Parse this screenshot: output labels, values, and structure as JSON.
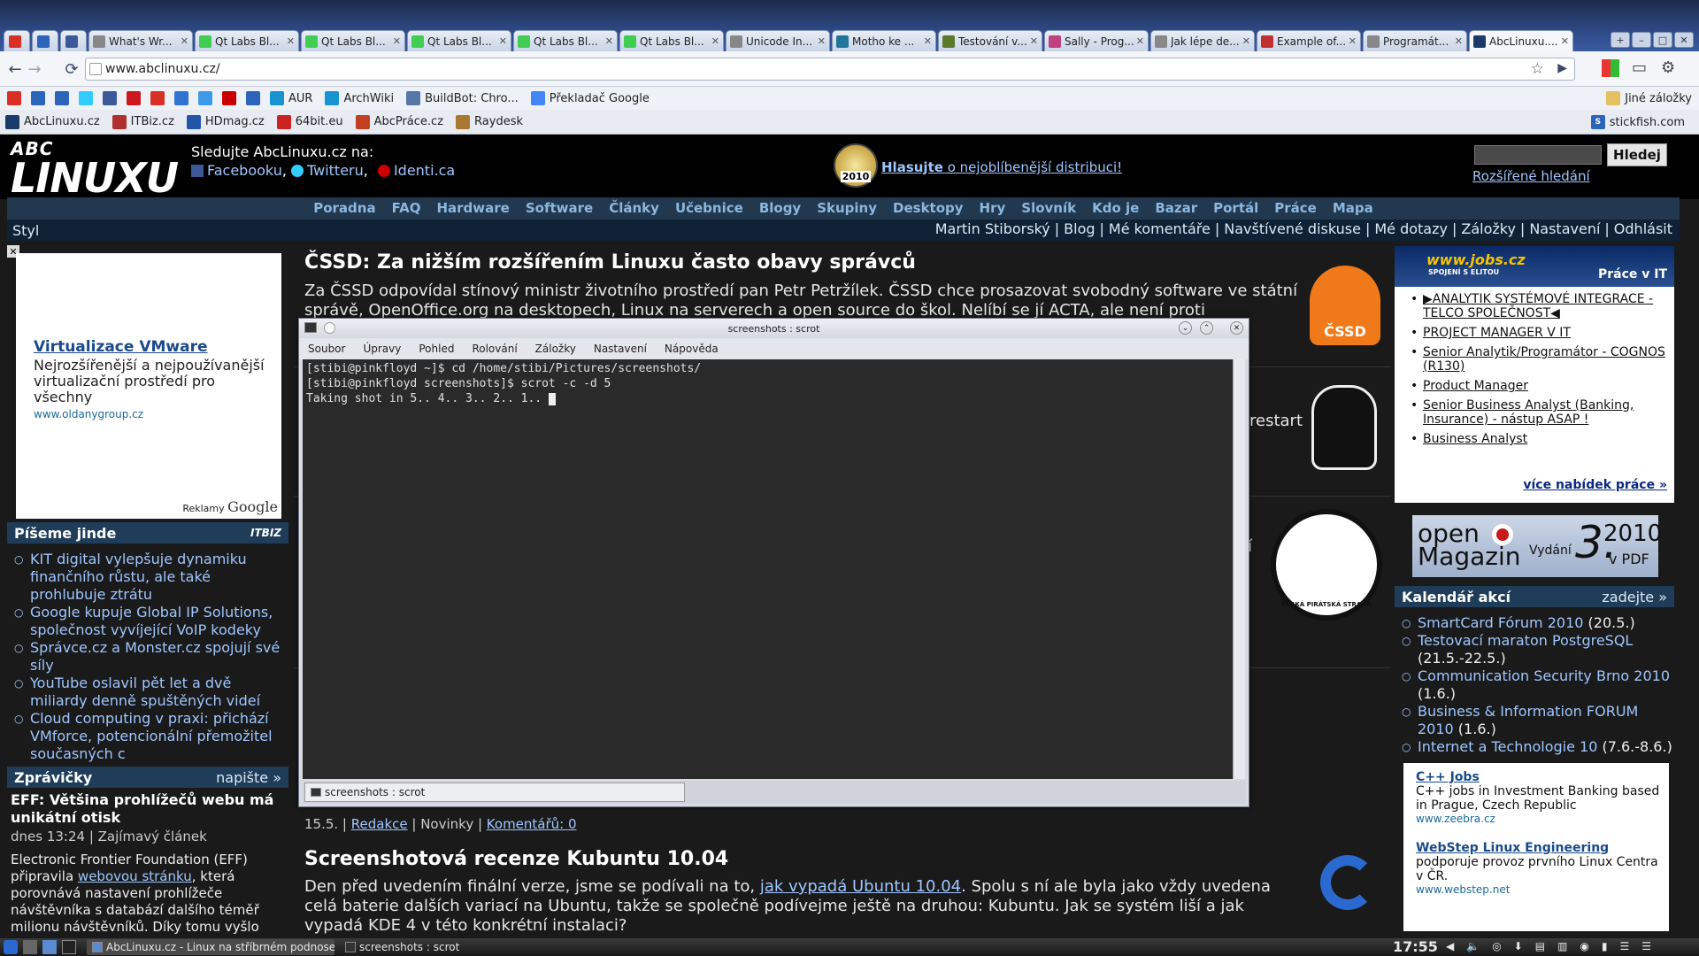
{
  "browser": {
    "tabs": [
      {
        "label": "",
        "icon": "gmail-icon",
        "color": "#d93025",
        "pinned": true
      },
      {
        "label": "",
        "icon": "rss-icon",
        "color": "#2b64b8",
        "pinned": true
      },
      {
        "label": "",
        "icon": "facebook-icon",
        "color": "#3b5998",
        "pinned": true
      },
      {
        "label": "What's Wr...",
        "icon": "page-icon",
        "color": "#888888"
      },
      {
        "label": "Qt Labs Bl...",
        "icon": "qt-icon",
        "color": "#41cd52"
      },
      {
        "label": "Qt Labs Bl...",
        "icon": "qt-icon",
        "color": "#41cd52"
      },
      {
        "label": "Qt Labs Bl...",
        "icon": "qt-icon",
        "color": "#41cd52"
      },
      {
        "label": "Qt Labs Bl...",
        "icon": "qt-icon",
        "color": "#41cd52"
      },
      {
        "label": "Qt Labs Bl...",
        "icon": "qt-icon",
        "color": "#41cd52"
      },
      {
        "label": "Unicode In...",
        "icon": "page-icon",
        "color": "#888888"
      },
      {
        "label": "Motho ke ...",
        "icon": "wordpress-icon",
        "color": "#21759b"
      },
      {
        "label": "Testování v...",
        "icon": "page-icon",
        "color": "#5a7a2a"
      },
      {
        "label": "Sally - Prog...",
        "icon": "page-icon",
        "color": "#c04080"
      },
      {
        "label": "Jak lépe de...",
        "icon": "page-icon",
        "color": "#888888"
      },
      {
        "label": "Example of...",
        "icon": "page-icon",
        "color": "#c03030"
      },
      {
        "label": "Programát...",
        "icon": "page-icon",
        "color": "#888888"
      },
      {
        "label": "AbcLinuxu....",
        "icon": "abclinuxu-icon",
        "color": "#1a3a6a",
        "active": true
      }
    ],
    "url": "www.abclinuxu.cz/",
    "bookmarks_row1": [
      {
        "label": "",
        "icon": "gmail-icon",
        "color": "#d93025"
      },
      {
        "label": "",
        "icon": "reader-icon",
        "color": "#2b64b8"
      },
      {
        "label": "",
        "icon": "calendar-icon",
        "color": "#2b64b8"
      },
      {
        "label": "",
        "icon": "twitter-icon",
        "color": "#33ccff"
      },
      {
        "label": "",
        "icon": "facebook-icon",
        "color": "#3b5998"
      },
      {
        "label": "",
        "icon": "youtube-icon",
        "color": "#cc181e"
      },
      {
        "label": "",
        "icon": "gmail-icon",
        "color": "#d93025"
      },
      {
        "label": "",
        "icon": "delicious-icon",
        "color": "#3274d1"
      },
      {
        "label": "",
        "icon": "dropbox-icon",
        "color": "#3d9ae8"
      },
      {
        "label": "",
        "icon": "yahoo-icon",
        "color": "#cc0000"
      },
      {
        "label": "",
        "icon": "check-icon",
        "color": "#2b64b8"
      },
      {
        "label": "AUR",
        "icon": "arch-icon",
        "color": "#1793d1"
      },
      {
        "label": "ArchWiki",
        "icon": "arch-icon",
        "color": "#1793d1"
      },
      {
        "label": "BuildBot: Chro...",
        "icon": "buildbot-icon",
        "color": "#5577aa"
      },
      {
        "label": "Překladač Google",
        "icon": "google-translate-icon",
        "color": "#4285f4"
      }
    ],
    "other_bookmarks": "Jiné záložky",
    "bookmarks_row2": [
      {
        "label": "AbcLinuxu.cz",
        "icon": "abclinuxu-icon",
        "color": "#1a3a6a"
      },
      {
        "label": "ITBiz.cz",
        "icon": "itbiz-icon",
        "color": "#b03030"
      },
      {
        "label": "HDmag.cz",
        "icon": "hdmag-icon",
        "color": "#2255aa"
      },
      {
        "label": "64bit.eu",
        "icon": "64bit-icon",
        "color": "#cc2222"
      },
      {
        "label": "AbcPráce.cz",
        "icon": "abcprace-icon",
        "color": "#c04020"
      },
      {
        "label": "Raydesk",
        "icon": "raydesk-icon",
        "color": "#aa7733"
      }
    ],
    "stickfish": "stickfish.com"
  },
  "site": {
    "logo_top": "ABC",
    "logo_main": "LINUXU",
    "follow_label": "Sledujte AbcLinuxu.cz na:",
    "follow_links": [
      "Facebooku",
      "Twitteru",
      "Identi.ca"
    ],
    "badge_year": "2010",
    "poll_link": "Hlasujte",
    "poll_text": " o nejoblíbenější distribuci!",
    "search_button": "Hledej",
    "advanced_search": "Rozšířené hledání",
    "main_nav": [
      "Poradna",
      "FAQ",
      "Hardware",
      "Software",
      "Články",
      "Učebnice",
      "Blogy",
      "Skupiny",
      "Desktopy",
      "Hry",
      "Slovník",
      "Kdo je",
      "Bazar",
      "Portál",
      "Práce",
      "Mapa"
    ],
    "style_label": "Styl",
    "user_nav": [
      "Martin Stiborský",
      "Blog",
      "Mé komentáře",
      "Navštívené diskuse",
      "Mé dotazy",
      "Záložky",
      "Nastavení",
      "Odhlásit"
    ],
    "ad": {
      "title": "Virtualizace VMware",
      "text": "Nejrozšířenější a nejpoužívanější virtualizační prostředí pro všechny",
      "url": "www.oldanygroup.cz",
      "footer": "Reklamy",
      "footer_brand": "Google"
    },
    "piseme": {
      "title": "Píšeme jinde",
      "brand": "ITBIZ",
      "items": [
        "KIT digital vylepšuje dynamiku finančního růstu, ale také prohlubuje ztrátu",
        "Google kupuje Global IP Solutions, společnost vyvíjející VoIP kodeky",
        "Správce.cz a Monster.cz spojují své síly",
        "YouTube oslavil pět let a dvě miliardy denně spuštěných videí",
        "Cloud computing v praxi: přichází VMforce, potencionální přemožitel současných c"
      ]
    },
    "zpravicky": {
      "title": "Zprávičky",
      "action": "napište »",
      "headline": "EFF: Většina prohlížečů webu má unikátní otisk",
      "meta": "dnes 13:24 | Zajímavý článek",
      "body_before": "Electronic Frontier Foundation (EFF) připravila ",
      "body_link": "webovou stránku",
      "body_after": ", která porovnává nastavení prohlížeče návštěvníka s databází dalšího téměř milionu návštěvníků. Díky tomu vyšlo"
    },
    "articles": [
      {
        "title": "ČSSD: Za nižším rozšířením Linuxu často obavy správců",
        "text": "Za ČSSD odpovídal stínový ministr životního prostředí pan Petr Petržílek. ČSSD chce prosazovat svobodný software ve státní správě, OpenOffice.org na desktopech, Linux na serverech a open source do škol. Nelíbí se jí ACTA, ale není proti spotřebitelským",
        "logo": "ČSSD"
      },
      {
        "partial_text": "restart"
      },
      {
        "partial_text": "í",
        "logo": "ČESKÁ PIRÁTSKÁ STRANA"
      }
    ],
    "meta_line": {
      "date": "15.5. | ",
      "author": "Redakce",
      "section": " | Novinky | ",
      "comments": "Komentářů: 0"
    },
    "article_kubuntu": {
      "title": "Screenshotová recenze Kubuntu 10.04",
      "text_before": "Den před uvedením finální verze, jsme se podívali na to, ",
      "text_link": "jak vypadá Ubuntu 10.04",
      "text_after": ". Spolu s ní ale byla jako vždy uvedena celá baterie dalších variací na Ubuntu, takže se společně podívejme ještě na druhou: Kubuntu. Jak se systém liší a jak vypadá KDE 4 v této konkrétní instalaci?"
    },
    "jobs": {
      "brand": "www.jobs.cz",
      "brand_sub": "SPOJENÍ S ELITOU",
      "heading": "Práce v IT",
      "items": [
        "▶ANALYTIK SYSTÉMOVÉ INTEGRACE - TELCO SPOLEČNOST◀",
        "PROJECT MANAGER V IT",
        "Senior Analytik/Programátor - COGNOS (R130)",
        "Product Manager",
        "Senior Business Analyst (Banking, Insurance) - nástup ASAP !",
        "Business Analyst"
      ],
      "more": "více nabídek práce »"
    },
    "openmag": {
      "line1": "open",
      "line2": "Magazin",
      "issue_label": "Vydání",
      "issue": "3.",
      "year": "2010",
      "format": "v PDF"
    },
    "calendar": {
      "title": "Kalendář akcí",
      "action": "zadejte »",
      "items": [
        {
          "name": "SmartCard Fórum 2010",
          "date": " (20.5.)"
        },
        {
          "name": "Testovací maraton PostgreSQL",
          "date": " (21.5.-22.5.)"
        },
        {
          "name": "Communication Security Brno 2010",
          "date": " (1.6.)"
        },
        {
          "name": "Business & Information FORUM 2010",
          "date": " (1.6.)"
        },
        {
          "name": "Internet a Technologie 10",
          "date": " (7.6.-8.6.)"
        }
      ]
    },
    "textads": [
      {
        "title": "C++ Jobs",
        "text": "C++ jobs in Investment Banking based in Prague, Czech Republic",
        "url": "www.zeebra.cz"
      },
      {
        "title": "WebStep Linux Engineering",
        "text": "podporuje provoz prvního Linux Centra v ČR.",
        "url": "www.webstep.net"
      }
    ]
  },
  "terminal": {
    "title": "screenshots : scrot",
    "menu": [
      "Soubor",
      "Úpravy",
      "Pohled",
      "Rolování",
      "Záložky",
      "Nastavení",
      "Nápověda"
    ],
    "lines": [
      "[stibi@pinkfloyd ~]$ cd /home/stibi/Pictures/screenshots/",
      "[stibi@pinkfloyd screenshots]$ scrot -c -d 5",
      "Taking shot in 5.. 4.. 3.. 2.. 1.. "
    ],
    "tab_label": "screenshots : scrot"
  },
  "taskbar": {
    "tasks": [
      "AbcLinuxu.cz - Linux na stříbrném podnose - Ch",
      "screenshots : scrot"
    ],
    "clock": "17:55"
  }
}
